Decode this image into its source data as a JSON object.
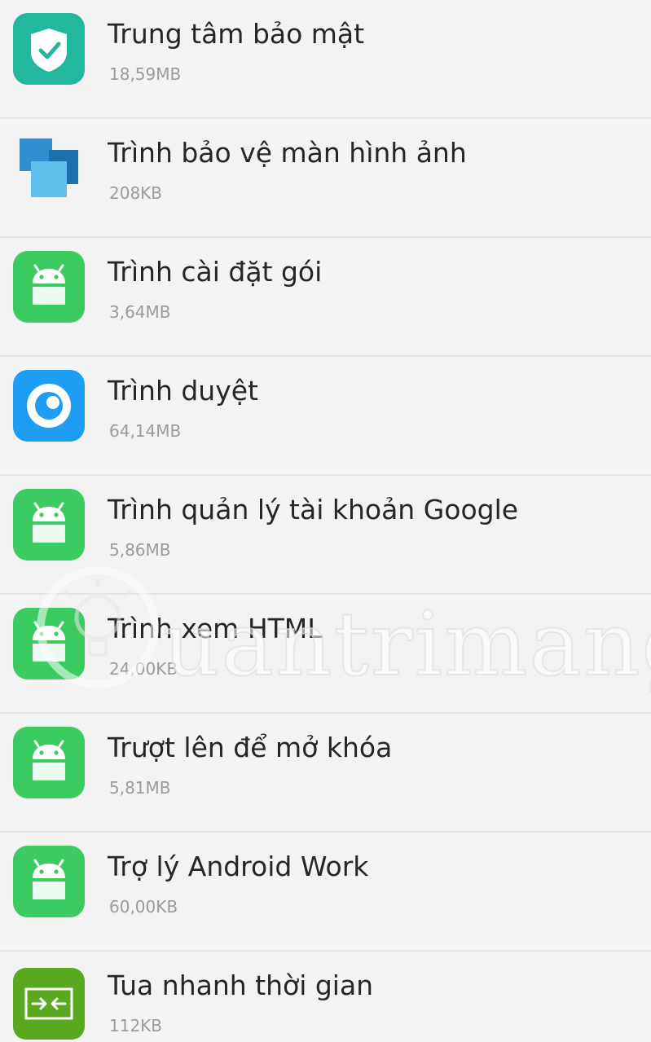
{
  "apps": [
    {
      "name": "Trung tâm bảo mật",
      "size": "18,59MB",
      "icon": "shield-check-icon",
      "color": "#22b8a0"
    },
    {
      "name": "Trình bảo vệ màn hình ảnh",
      "size": "208KB",
      "icon": "photo-screensaver-icon",
      "color": "#2f8fd0"
    },
    {
      "name": "Trình cài đặt gói",
      "size": "3,64MB",
      "icon": "android-icon",
      "color": "#3ccb61"
    },
    {
      "name": "Trình duyệt",
      "size": "64,14MB",
      "icon": "browser-icon",
      "color": "#1e9ef2"
    },
    {
      "name": "Trình quản lý tài khoản Google",
      "size": "5,86MB",
      "icon": "android-icon",
      "color": "#3ccb61"
    },
    {
      "name": "Trình xem HTML",
      "size": "24,00KB",
      "icon": "android-icon",
      "color": "#3ccb61"
    },
    {
      "name": "Trượt lên để mở khóa",
      "size": "5,81MB",
      "icon": "android-icon",
      "color": "#3ccb61"
    },
    {
      "name": "Trợ lý Android Work",
      "size": "60,00KB",
      "icon": "android-icon",
      "color": "#3ccb61"
    },
    {
      "name": "Tua nhanh thời gian",
      "size": "112KB",
      "icon": "timelapse-icon",
      "color": "#5aa820"
    }
  ],
  "watermark": {
    "text": "uantrimang",
    "icon": "lightbulb-icon"
  }
}
